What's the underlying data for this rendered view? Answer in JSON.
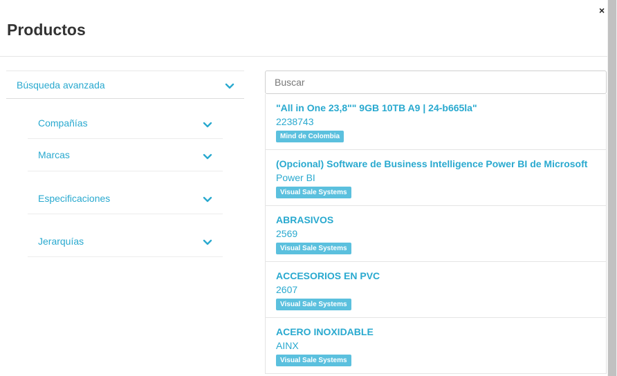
{
  "modal": {
    "title": "Productos",
    "close_label": "×"
  },
  "filters": {
    "advanced_label": "Búsqueda avanzada",
    "items": [
      {
        "label": "Compañías"
      },
      {
        "label": "Marcas"
      },
      {
        "label": "Especificaciones"
      },
      {
        "label": "Jerarquías"
      }
    ]
  },
  "search": {
    "placeholder": "Buscar",
    "value": ""
  },
  "products": [
    {
      "name": "\"All in One 23,8\"\" 9GB 10TB A9 | 24-b665la\"",
      "code": "2238743",
      "company": "Mind de Colombia"
    },
    {
      "name": "(Opcional) Software de Business Intelligence Power BI de Microsoft",
      "code": "Power BI",
      "company": "Visual Sale Systems"
    },
    {
      "name": "ABRASIVOS",
      "code": "2569",
      "company": "Visual Sale Systems"
    },
    {
      "name": "ACCESORIOS EN PVC",
      "code": "2607",
      "company": "Visual Sale Systems"
    },
    {
      "name": "ACERO INOXIDABLE",
      "code": "AINX",
      "company": "Visual Sale Systems"
    }
  ],
  "colors": {
    "accent": "#29a9cf",
    "badge": "#5bc0de"
  },
  "icons": {
    "close": "close-icon",
    "expand": "chevron-down-icon"
  }
}
